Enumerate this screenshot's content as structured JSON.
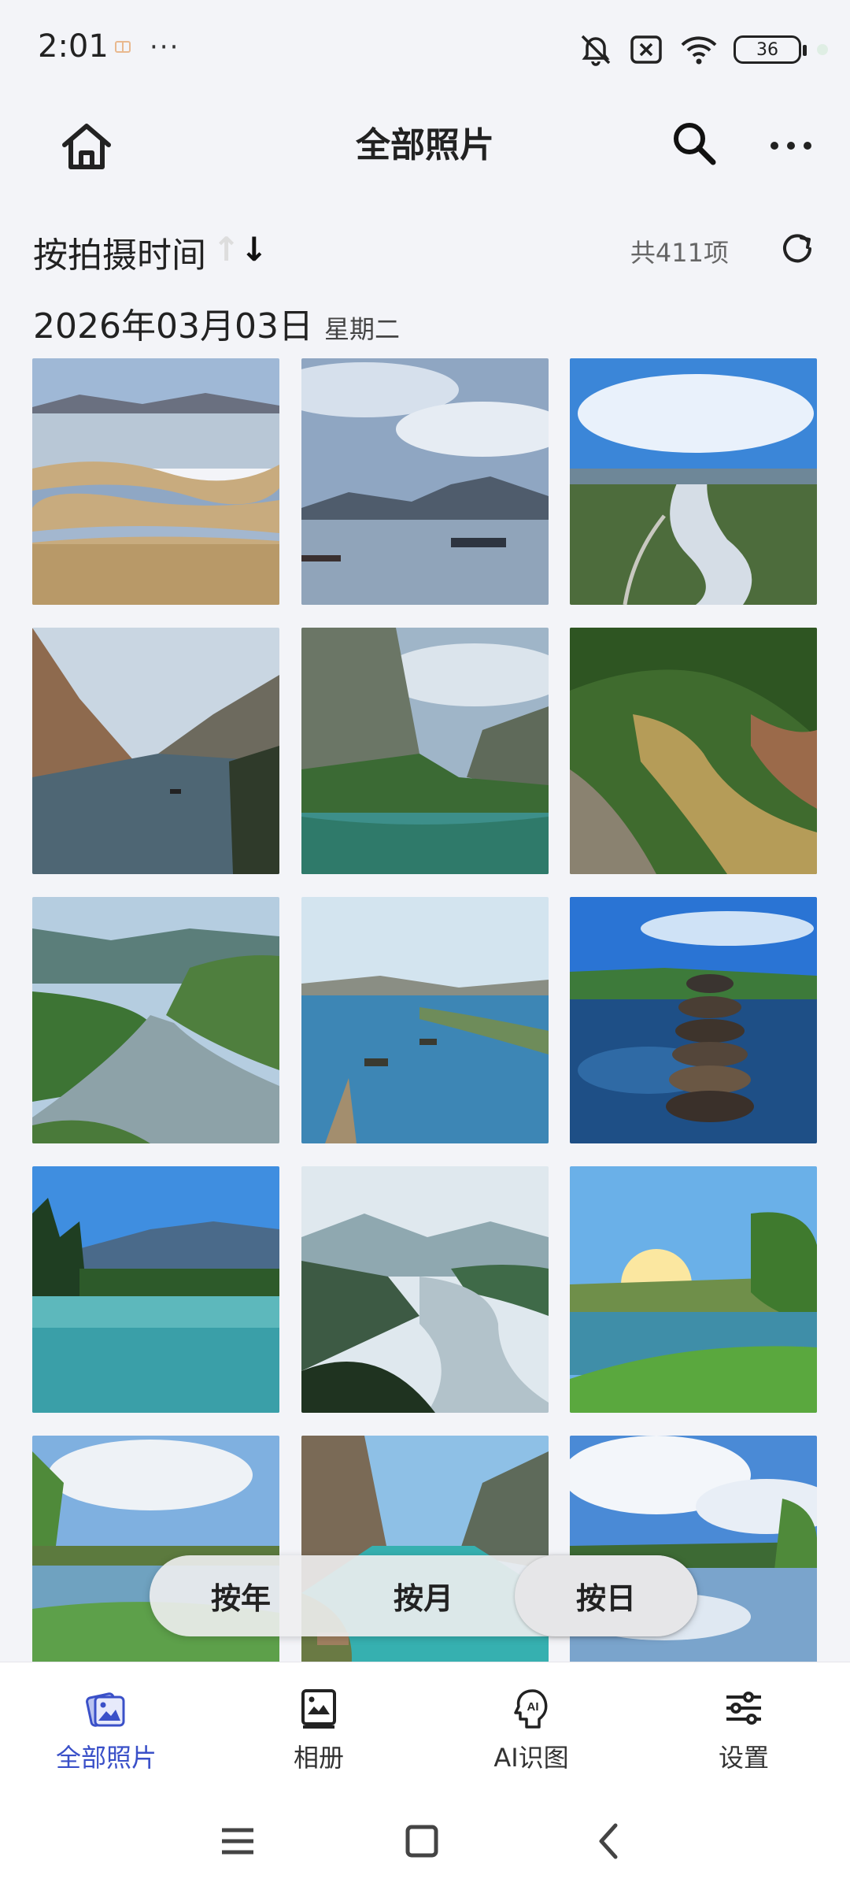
{
  "status_bar": {
    "time": "2:01",
    "more": "···",
    "battery": "36"
  },
  "header": {
    "title": "全部照片",
    "icons": [
      "home-icon",
      "search-icon",
      "more-icon"
    ]
  },
  "sort": {
    "label": "按拍摄时间",
    "count": "共411项"
  },
  "date_group": {
    "date": "2026年03月03日",
    "weekday": "星期二"
  },
  "photos": [
    "plateau-lake-grassland",
    "lake-ferry-clouds",
    "aerial-braided-river",
    "gorge-river-boat",
    "canyon-river-reflection",
    "muddy-river-hills",
    "river-bend-green-hills",
    "blue-river-boats",
    "stacked-stones-river",
    "turquoise-lake-forest",
    "misty-mountains-river",
    "sunlit-lake-meadow",
    "cloudy-lake-grass",
    "turquoise-gorge-boat",
    "cloud-reflection-lake"
  ],
  "scale_switch": {
    "year": "按年",
    "month": "按月",
    "day": "按日",
    "active": "day"
  },
  "bottom_nav": [
    {
      "label": "全部照片",
      "icon": "photos-icon",
      "active": true
    },
    {
      "label": "相册",
      "icon": "album-icon",
      "active": false
    },
    {
      "label": "AI识图",
      "icon": "ai-icon",
      "active": false
    },
    {
      "label": "设置",
      "icon": "settings-icon",
      "active": false
    }
  ],
  "colors": {
    "accent": "#3a50c8",
    "background": "#f3f4f8"
  }
}
